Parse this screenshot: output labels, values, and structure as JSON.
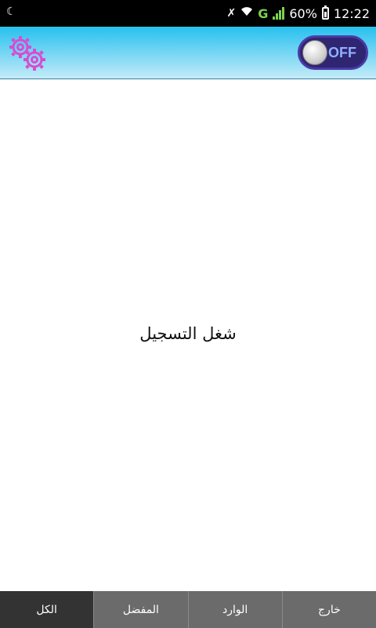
{
  "status_bar": {
    "left_icon": "moon-icon",
    "battery": "60%",
    "time": "12:22",
    "network": "G"
  },
  "toolbar": {
    "settings_icon": "gears-icon",
    "toggle_label": "OFF"
  },
  "main": {
    "message": "شغل التسجيل"
  },
  "tabs": [
    {
      "label": "الكل"
    },
    {
      "label": "المفضل"
    },
    {
      "label": "الوارد"
    },
    {
      "label": "خارج"
    }
  ],
  "colors": {
    "appbar_top": "#26c0ee",
    "appbar_bottom": "#c4ebf9",
    "gear": "#d94bd1",
    "toggle_bg": "#2f2570",
    "tab_active": "#333333",
    "tab_inactive": "#6b6b6b"
  }
}
